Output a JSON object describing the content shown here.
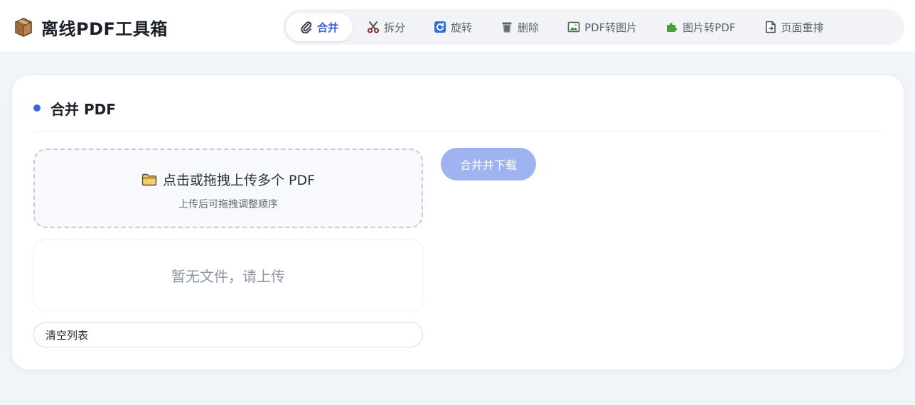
{
  "app": {
    "title": "离线PDF工具箱"
  },
  "nav": {
    "tabs": [
      {
        "label": "合并",
        "icon": "paperclip-icon",
        "active": true
      },
      {
        "label": "拆分",
        "icon": "scissors-icon",
        "active": false
      },
      {
        "label": "旋转",
        "icon": "rotate-icon",
        "active": false
      },
      {
        "label": "删除",
        "icon": "trash-icon",
        "active": false
      },
      {
        "label": "PDF转图片",
        "icon": "image-icon",
        "active": false
      },
      {
        "label": "图片转PDF",
        "icon": "puzzle-icon",
        "active": false
      },
      {
        "label": "页面重排",
        "icon": "page-icon",
        "active": false
      }
    ]
  },
  "panel": {
    "title": "合并 PDF",
    "dropzone": {
      "main": "点击或拖拽上传多个 PDF",
      "sub": "上传后可拖拽调整顺序",
      "icon": "folder-icon"
    },
    "empty_text": "暂无文件，请上传",
    "clear_label": "清空列表",
    "merge_label": "合并并下载"
  },
  "colors": {
    "accent": "#3f66dc",
    "button_disabled": "#9eb3ef",
    "background": "#f1f4f8"
  }
}
